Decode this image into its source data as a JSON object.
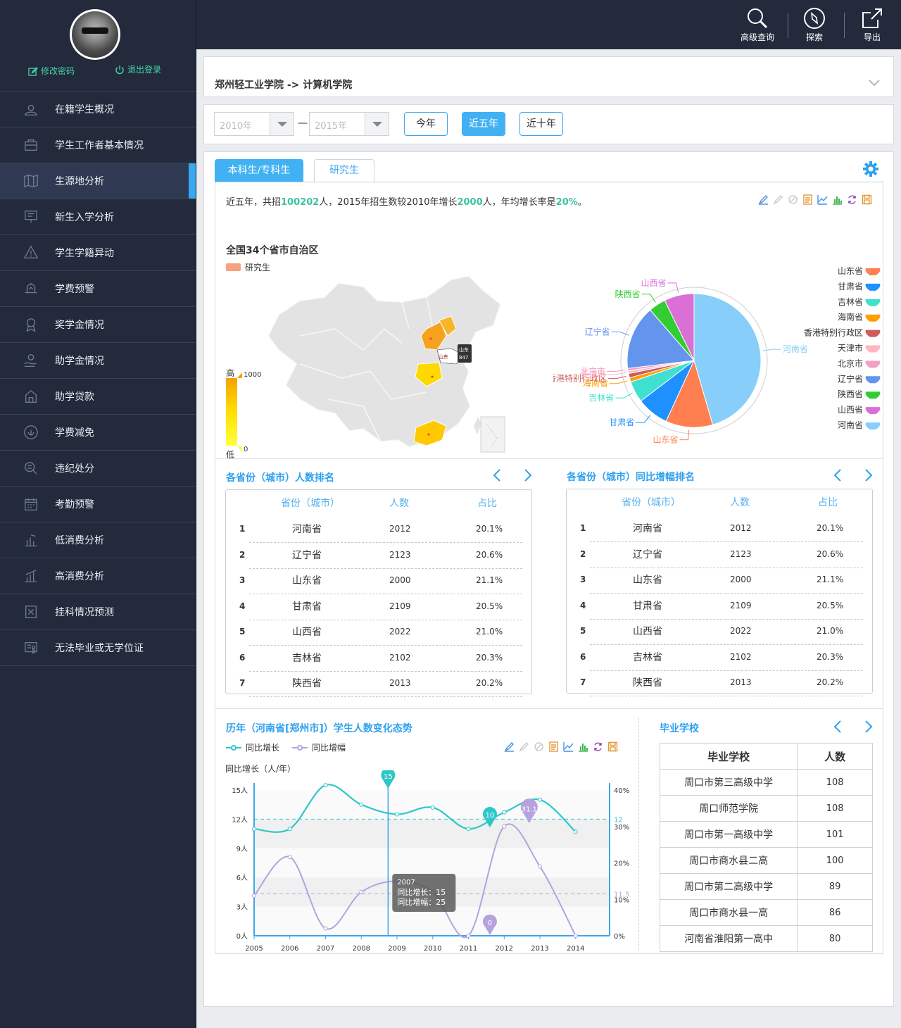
{
  "sidebar": {
    "profile": {
      "change_password": "修改密码",
      "logout": "退出登录"
    },
    "items": [
      {
        "label": "在籍学生概况",
        "icon": "students-icon"
      },
      {
        "label": "学生工作者基本情况",
        "icon": "briefcase-icon"
      },
      {
        "label": "生源地分析",
        "icon": "map-icon",
        "active": true
      },
      {
        "label": "新生入学分析",
        "icon": "board-icon"
      },
      {
        "label": "学生学籍异动",
        "icon": "warning-icon"
      },
      {
        "label": "学费预警",
        "icon": "alarm-icon"
      },
      {
        "label": "奖学金情况",
        "icon": "medal-icon"
      },
      {
        "label": "助学金情况",
        "icon": "hand-coin-icon"
      },
      {
        "label": "助学贷款",
        "icon": "loan-icon"
      },
      {
        "label": "学费减免",
        "icon": "discount-icon"
      },
      {
        "label": "违纪处分",
        "icon": "penalty-icon"
      },
      {
        "label": "考勤预警",
        "icon": "calendar-icon"
      },
      {
        "label": "低消费分析",
        "icon": "low-bar-icon"
      },
      {
        "label": "高消费分析",
        "icon": "high-bar-icon"
      },
      {
        "label": "挂科情况预测",
        "icon": "fail-icon"
      },
      {
        "label": "无法毕业或无学位证",
        "icon": "certificate-icon"
      }
    ]
  },
  "topbar": {
    "advanced_search": "高级查询",
    "explore": "探索",
    "export": "导出"
  },
  "breadcrumb": "郑州轻工业学院  -> 计算机学院",
  "filter": {
    "start_placeholder": "2010年",
    "end_placeholder": "2015年",
    "dash": "—",
    "btn_this_year": "今年",
    "btn_five_years": "近五年",
    "btn_ten_years": "近十年"
  },
  "tabs": {
    "undergrad": "本科生/专科生",
    "graduate": "研究生"
  },
  "summary": {
    "p1": "近五年，共招",
    "total": "100202",
    "p2": "人，2015年招生数较2010年增长",
    "growth": "2000",
    "p3": "人，年均增长率是",
    "rate": "20%",
    "p4": "。"
  },
  "map": {
    "title": "全国34个省市自治区",
    "legend": "研究生",
    "scale_high": "高",
    "scale_low": "低",
    "scale_max": "1000",
    "scale_min": "0",
    "tooltip_name": "山东",
    "tooltip_value": "847",
    "label_shandong": "山东"
  },
  "chart_data": [
    {
      "type": "pie",
      "slices": [
        {
          "name": "河南省",
          "value": 44,
          "color": "#87cefa"
        },
        {
          "name": "山东省",
          "value": 11,
          "color": "#ff7f50"
        },
        {
          "name": "甘肃省",
          "value": 7.5,
          "color": "#1e90ff"
        },
        {
          "name": "吉林省",
          "value": 5,
          "color": "#40e0d0"
        },
        {
          "name": "海南省",
          "value": 1,
          "color": "#ff9f00"
        },
        {
          "name": "香港特别行政区",
          "value": 1,
          "color": "#cd5c5c"
        },
        {
          "name": "天津市",
          "value": 0.6,
          "color": "#ffb6c1"
        },
        {
          "name": "北京市",
          "value": 0.6,
          "color": "#f0a0c8"
        },
        {
          "name": "辽宁省",
          "value": 15,
          "color": "#6495ed"
        },
        {
          "name": "陕西省",
          "value": 4,
          "color": "#32cd32"
        },
        {
          "name": "山西省",
          "value": 7,
          "color": "#da70d6"
        }
      ],
      "legend": [
        "山东省",
        "甘肃省",
        "吉林省",
        "海南省",
        "香港特别行政区",
        "天津市",
        "北京市",
        "辽宁省",
        "陕西省",
        "山西省",
        "河南省"
      ]
    },
    {
      "type": "line",
      "title": "历年（河南省[郑州市]）学生人数变化态势",
      "ylabel": "同比增长（人/年）",
      "x": [
        "2005",
        "2006",
        "2007",
        "2008",
        "2009",
        "2010",
        "2011",
        "2012",
        "2013",
        "2014"
      ],
      "yticks_left": [
        "0人",
        "3人",
        "6人",
        "9人",
        "12人",
        "15人"
      ],
      "yticks_right": [
        "0%",
        "10%",
        "20%",
        "30%",
        "40%"
      ],
      "ylim_left": [
        0,
        15
      ],
      "ylim_right": [
        0,
        40
      ],
      "series": [
        {
          "name": "同比增长",
          "axis": "left",
          "color": "#2ec7c9",
          "values": [
            11,
            11,
            15.5,
            13.5,
            12.5,
            13.2,
            11,
            12.7,
            14,
            10.7
          ]
        },
        {
          "name": "同比增幅",
          "axis": "right",
          "color": "#b6a2de",
          "values": [
            11,
            21.6,
            2,
            12,
            15,
            12,
            0,
            30,
            19,
            0
          ]
        }
      ],
      "mark_points": {
        "s1_max": "15",
        "s1_min": "10",
        "s2_max": "31.1",
        "s2_min": "0"
      },
      "mark_lines": {
        "s1_avg": "12",
        "s2_avg": "11.5"
      },
      "tooltip": {
        "year": "2007",
        "l1": "同比增长：15",
        "l2": "同比增幅：25"
      }
    }
  ],
  "rank1": {
    "title": "各省份（城市）人数排名",
    "headers": [
      "省份（城市）",
      "人数",
      "占比"
    ],
    "rows": [
      {
        "n": "1",
        "name": "河南省",
        "count": "2012",
        "pct": "20.1%"
      },
      {
        "n": "2",
        "name": "辽宁省",
        "count": "2123",
        "pct": "20.6%"
      },
      {
        "n": "3",
        "name": "山东省",
        "count": "2000",
        "pct": "21.1%"
      },
      {
        "n": "4",
        "name": "甘肃省",
        "count": "2109",
        "pct": "20.5%"
      },
      {
        "n": "5",
        "name": "山西省",
        "count": "2022",
        "pct": "21.0%"
      },
      {
        "n": "6",
        "name": "吉林省",
        "count": "2102",
        "pct": "20.3%"
      },
      {
        "n": "7",
        "name": "陕西省",
        "count": "2013",
        "pct": "20.2%"
      }
    ]
  },
  "rank2": {
    "title": "各省份（城市）同比增幅排名",
    "headers": [
      "省份（城市）",
      "人数",
      "占比"
    ],
    "rows": [
      {
        "n": "1",
        "name": "河南省",
        "count": "2012",
        "pct": "20.1%"
      },
      {
        "n": "2",
        "name": "辽宁省",
        "count": "2123",
        "pct": "20.6%"
      },
      {
        "n": "3",
        "name": "山东省",
        "count": "2000",
        "pct": "21.1%"
      },
      {
        "n": "4",
        "name": "甘肃省",
        "count": "2109",
        "pct": "20.5%"
      },
      {
        "n": "5",
        "name": "山西省",
        "count": "2022",
        "pct": "21.0%"
      },
      {
        "n": "6",
        "name": "吉林省",
        "count": "2102",
        "pct": "20.3%"
      },
      {
        "n": "7",
        "name": "陕西省",
        "count": "2013",
        "pct": "20.2%"
      }
    ]
  },
  "schools": {
    "title": "毕业学校",
    "headers": [
      "毕业学校",
      "人数"
    ],
    "rows": [
      {
        "name": "周口市第三高级中学",
        "count": "108"
      },
      {
        "name": "周口师范学院",
        "count": "108"
      },
      {
        "name": "周口市第一高级中学",
        "count": "101"
      },
      {
        "name": "周口市商水县二高",
        "count": "100"
      },
      {
        "name": "周口市第二高级中学",
        "count": "89"
      },
      {
        "name": "周口市商水县一高",
        "count": "86"
      },
      {
        "name": "河南省淮阳第一高中",
        "count": "80"
      }
    ]
  }
}
